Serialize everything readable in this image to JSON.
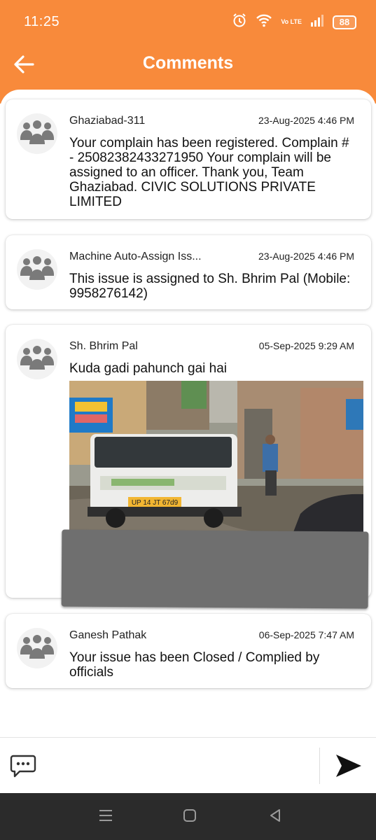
{
  "status_bar": {
    "time": "11:25",
    "network_label": "Vo LTE",
    "battery": "88"
  },
  "header": {
    "title": "Comments"
  },
  "comments": [
    {
      "author": "Ghaziabad-311",
      "timestamp": "23-Aug-2025 4:46 PM",
      "message": "Your complain has been registered. Complain # - 25082382433271950 Your complain will be assigned to an officer. Thank you, Team Ghaziabad. CIVIC SOLUTIONS PRIVATE LIMITED"
    },
    {
      "author": "Machine Auto-Assign Iss...",
      "timestamp": "23-Aug-2025 4:46 PM",
      "message": "This issue is assigned to Sh. Bhrim Pal (Mobile: 9958276142)"
    },
    {
      "author": "Sh. Bhrim Pal",
      "timestamp": "05-Sep-2025 9:29 AM",
      "message": "Kuda gadi pahunch gai hai",
      "photo": {
        "plate": "UP 14 JT 67d9"
      }
    },
    {
      "author": "Ganesh Pathak",
      "timestamp": "06-Sep-2025 7:47 AM",
      "message": "Your issue has been Closed / Complied by officials"
    }
  ],
  "icons": {
    "back": "arrow-left-icon",
    "avatar": "people-group-icon",
    "composer": "chat-bubble-icon",
    "send": "send-icon",
    "nav": [
      "recents-icon",
      "home-icon",
      "back-triangle-icon"
    ]
  },
  "colors": {
    "accent": "#f88a3b",
    "nav_bar": "#2b2b2b",
    "text": "#111111",
    "avatar_bg": "#f2f2f2"
  }
}
